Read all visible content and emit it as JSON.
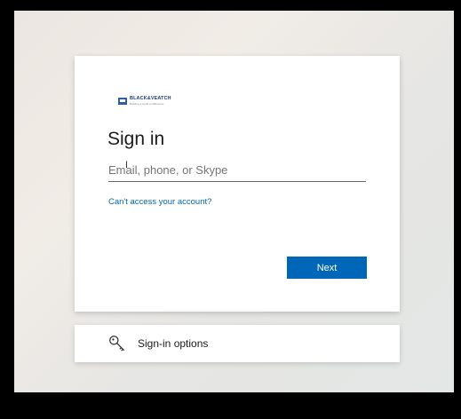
{
  "logo": {
    "name": "BLACK&VEATCH",
    "tagline": "Building a world of difference"
  },
  "signin": {
    "title": "Sign in",
    "email_placeholder": "Email, phone, or Skype",
    "email_value": "",
    "help_link": "Can't access your account?",
    "next_label": "Next"
  },
  "options": {
    "label": "Sign-in options",
    "icon": "key-icon"
  },
  "colors": {
    "accent": "#0067b8",
    "link": "#0067b8",
    "card": "#ffffff"
  }
}
